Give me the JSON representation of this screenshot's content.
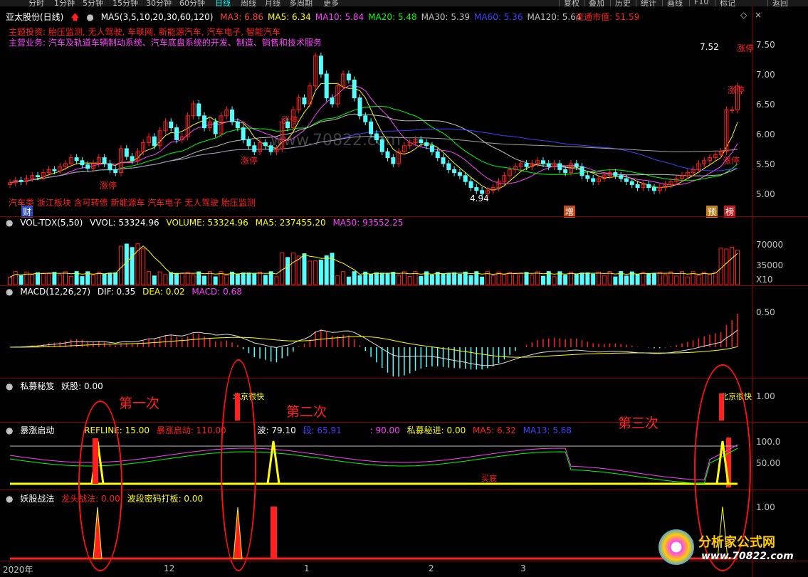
{
  "toolbar": {
    "periods": [
      "分时",
      "1分钟",
      "5分钟",
      "15分钟",
      "30分钟",
      "60分钟",
      "日线",
      "周线",
      "月线",
      "多周期",
      "更多"
    ],
    "right": [
      "复权",
      "叠加",
      "历史",
      "统计",
      "画线",
      "F10",
      "标记",
      "返回"
    ]
  },
  "price_panel": {
    "stock": "亚太股份(日线)",
    "ma_label": "MA5(3,5,10,20,30,60,120)",
    "ma": [
      {
        "k": "MA3",
        "v": "6.86",
        "c": "#ff4040"
      },
      {
        "k": "MA5",
        "v": "6.34",
        "c": "#ffff00"
      },
      {
        "k": "MA10",
        "v": "5.84",
        "c": "#ff40ff"
      },
      {
        "k": "MA20",
        "v": "5.48",
        "c": "#00ff00"
      },
      {
        "k": "MA30",
        "v": "5.39",
        "c": "#c0c0c0"
      },
      {
        "k": "MA60",
        "v": "5.36",
        "c": "#4040ff"
      },
      {
        "k": "MA120",
        "v": "5.64",
        "c": "#c0c0c0"
      }
    ],
    "float_cap_label": "流通市值",
    "float_cap": "51.59",
    "theme": "主题投资: 胎压监测, 无人驾驶, 车联网, 新能源汽车, 汽车电子, 智能汽车",
    "business": "主营业务: 汽车及轨道车辆制动系统、汽车底盘系统的开发、制造、销售和技术服务",
    "concepts": "汽车类 浙江板块 含可转债 新能源车 汽车电子 无人驾驶 胎压监测",
    "cai": "财",
    "zeng": "增",
    "yu": "预",
    "bang": "榜",
    "high_label": "7.52",
    "low_label": "4.94",
    "zt": "涨停",
    "yticks": [
      "7.50",
      "7.00",
      "6.50",
      "6.00",
      "5.50",
      "5.00"
    ],
    "watermark": "www.70822.com"
  },
  "vol_panel": {
    "title": "VOL-TDX(5,50)",
    "vvol": "VVOL: 53324.96",
    "volume": "VOLUME: 53324.96",
    "ma5": "MA5: 237455.20",
    "ma50": "MA50: 93552.25",
    "yticks": [
      "70000",
      "35000"
    ],
    "unit": "X10"
  },
  "macd_panel": {
    "title": "MACD(12,26,27)",
    "dif": "DIF: 0.35",
    "dea": "DEA: 0.02",
    "macd": "MACD: 0.68",
    "ytick": "0.50"
  },
  "smjf_panel": {
    "title": "私募秘笈",
    "yao": "妖股: 0.00",
    "ytick": "1.00",
    "tag": "北京很快"
  },
  "bzqd_panel": {
    "title": "暴涨启动",
    "refline": "REFLINE: 15.00",
    "bzqd": "暴涨启动: 110.00",
    "bo": "波: 79.10",
    "duan": "段: 65.91",
    "v90": ": 90.00",
    "smj": "私募秘进: 0.00",
    "ma5": "MA5: 6.32",
    "ma13": "MA13: 5.68",
    "yticks": [
      "100.0",
      "50.00"
    ],
    "maidi": "买底"
  },
  "ygzf_panel": {
    "title": "妖股战法",
    "ltzf": "龙头战法: 0.00",
    "bdmm": "波段密码打板: 0.00",
    "ytick": "1.00"
  },
  "xaxis": [
    "2020年",
    "12",
    "1",
    "2",
    "3"
  ],
  "annotations": [
    "第一次",
    "第二次",
    "第三次"
  ],
  "logo": {
    "name": "分析家公式网",
    "url": "www.70822.com"
  },
  "colors": {
    "up": "#ff2020",
    "down": "#54ffff",
    "yellow": "#ffff00",
    "magenta": "#ff40ff",
    "green": "#00ff00",
    "white": "#e0e0e0"
  },
  "chart_data": {
    "type": "candlestick",
    "ylim": [
      4.8,
      7.6
    ],
    "close": [
      5.18,
      5.22,
      5.2,
      5.25,
      5.3,
      5.28,
      5.35,
      5.4,
      5.38,
      5.45,
      5.5,
      5.6,
      5.55,
      5.48,
      5.42,
      5.5,
      5.6,
      5.5,
      5.4,
      5.35,
      5.75,
      5.62,
      5.55,
      5.7,
      5.85,
      5.95,
      5.8,
      6.05,
      6.2,
      6.1,
      5.9,
      5.95,
      6.3,
      6.5,
      6.3,
      6.1,
      6.2,
      6.0,
      6.3,
      6.4,
      6.2,
      6.1,
      5.9,
      5.8,
      5.7,
      5.85,
      5.8,
      5.7,
      5.75,
      6.2,
      6.1,
      6.4,
      6.6,
      6.5,
      6.8,
      7.3,
      7.0,
      6.6,
      6.5,
      6.8,
      7.0,
      6.9,
      6.6,
      6.3,
      6.2,
      6.0,
      5.9,
      5.7,
      5.6,
      5.5,
      5.7,
      5.8,
      5.85,
      5.9,
      5.85,
      5.8,
      5.7,
      5.6,
      5.5,
      5.4,
      5.35,
      5.3,
      5.2,
      5.1,
      5.05,
      5.0,
      5.05,
      5.1,
      5.2,
      5.3,
      5.4,
      5.45,
      5.5,
      5.45,
      5.5,
      5.55,
      5.5,
      5.45,
      5.5,
      5.4,
      5.35,
      5.5,
      5.45,
      5.3,
      5.25,
      5.2,
      5.25,
      5.3,
      5.35,
      5.3,
      5.25,
      5.2,
      5.15,
      5.1,
      5.15,
      5.1,
      5.05,
      5.1,
      5.15,
      5.2,
      5.25,
      5.3,
      5.35,
      5.4,
      5.5,
      5.55,
      5.6,
      5.65,
      5.7,
      6.4,
      6.4,
      6.8
    ]
  }
}
